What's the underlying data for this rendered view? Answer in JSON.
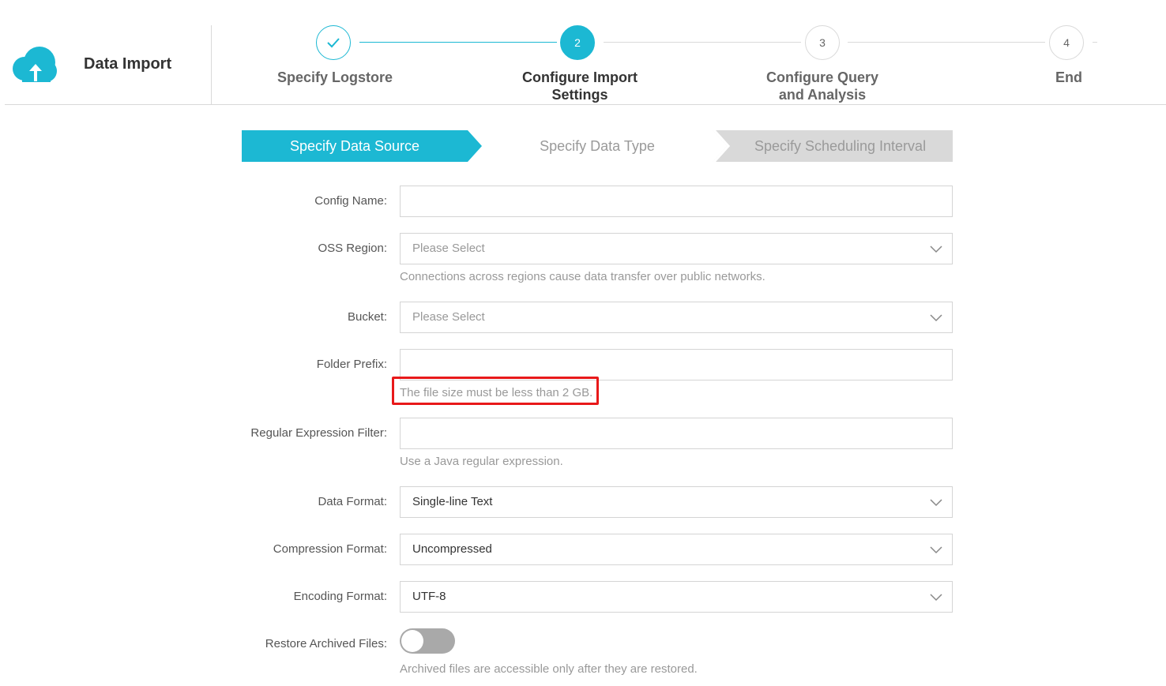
{
  "header": {
    "title": "Data Import",
    "steps": [
      {
        "number": "1",
        "label": "Specify Logstore",
        "state": "done",
        "icon": "check-icon"
      },
      {
        "number": "2",
        "label": "Configure Import Settings",
        "state": "active"
      },
      {
        "number": "3",
        "label": "Configure Query and Analysis",
        "state": "pending"
      },
      {
        "number": "4",
        "label": "End",
        "state": "pending"
      }
    ]
  },
  "substeps": [
    {
      "label": "Specify Data Source",
      "state": "active"
    },
    {
      "label": "Specify Data Type",
      "state": "inactive"
    },
    {
      "label": "Specify Scheduling Interval",
      "state": "inactive"
    }
  ],
  "form": {
    "config_name": {
      "label": "Config Name:",
      "value": ""
    },
    "oss_region": {
      "label": "OSS Region:",
      "placeholder": "Please Select",
      "help": "Connections across regions cause data transfer over public networks."
    },
    "bucket": {
      "label": "Bucket:",
      "placeholder": "Please Select"
    },
    "folder_prefix": {
      "label": "Folder Prefix:",
      "value": "",
      "help": "The file size must be less than 2 GB."
    },
    "regex_filter": {
      "label": "Regular Expression Filter:",
      "value": "",
      "help": "Use a Java regular expression."
    },
    "data_format": {
      "label": "Data Format:",
      "value": "Single-line Text"
    },
    "compression_format": {
      "label": "Compression Format:",
      "value": "Uncompressed"
    },
    "encoding_format": {
      "label": "Encoding Format:",
      "value": "UTF-8"
    },
    "restore_archived": {
      "label": "Restore Archived Files:",
      "enabled": false,
      "help": "Archived files are accessible only after they are restored."
    }
  },
  "colors": {
    "accent": "#1cb8d3",
    "highlight": "#e8191a",
    "inactive_step": "#d9d9d9"
  }
}
